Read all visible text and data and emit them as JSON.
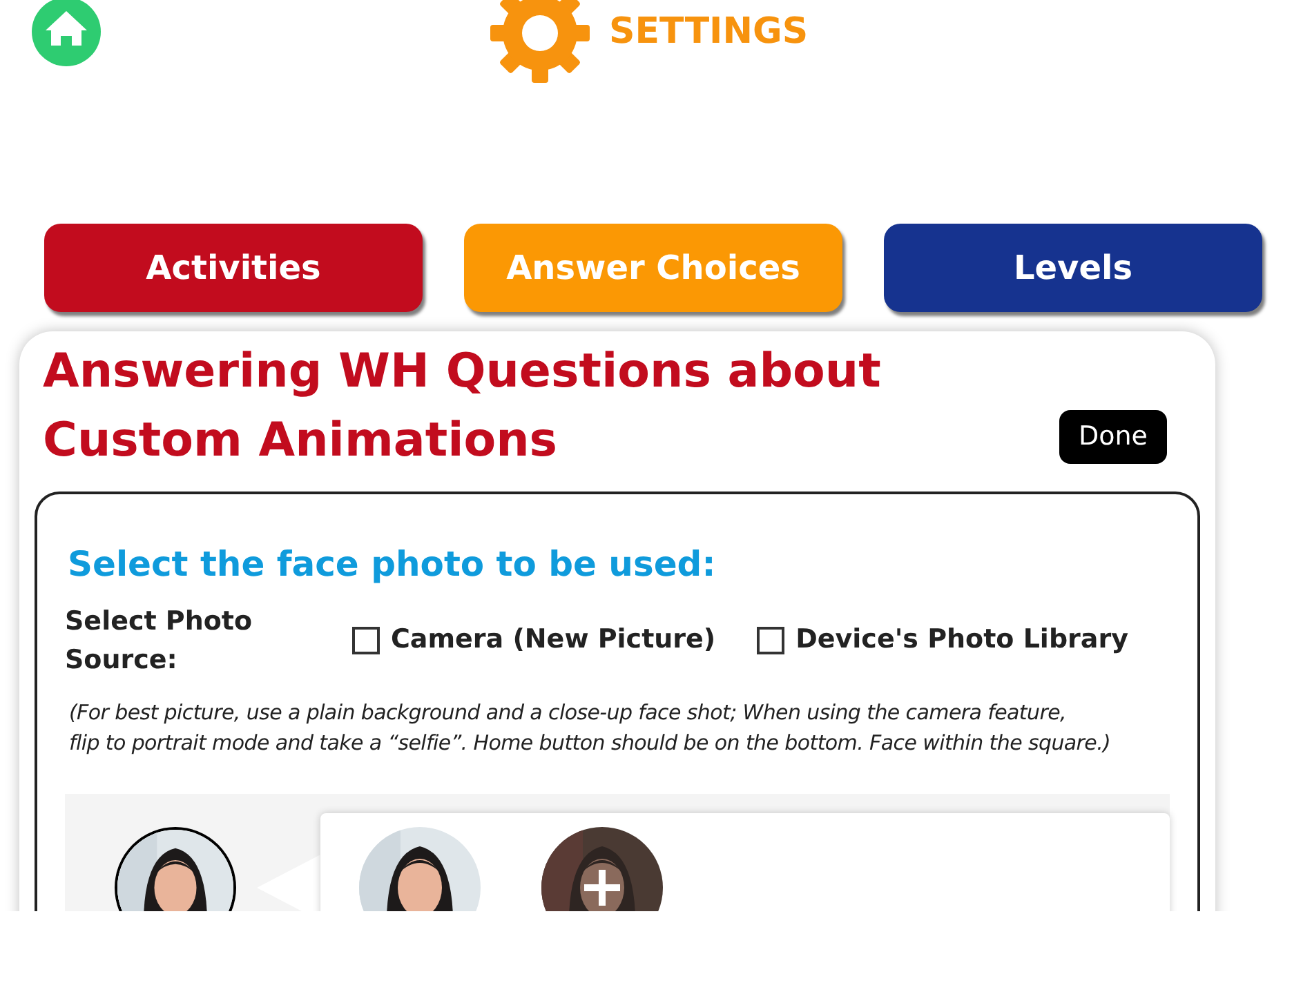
{
  "header": {
    "title": "SETTINGS"
  },
  "tabs": [
    {
      "label": "Activities",
      "color": "#c20c1e"
    },
    {
      "label": "Answer Choices",
      "color": "#fb9804"
    },
    {
      "label": "Levels",
      "color": "#16338f"
    }
  ],
  "panel": {
    "title_lines": [
      "Answering WH Questions about",
      "Custom Animations"
    ],
    "done_button": "Done",
    "section_heading": "Select the face photo to be used:",
    "source_label": "Select Photo Source:",
    "sources": [
      {
        "label": "Camera (New Picture)",
        "checked": false
      },
      {
        "label": "Device's Photo Library",
        "checked": false
      }
    ],
    "note_lines": [
      "(For best picture, use a plain background and a close-up face shot; When using the camera feature,",
      "flip to portrait mode and take a “selfie”. Home button should be on the bottom. Face within the square.)"
    ],
    "current_photo": {
      "kind": "picture"
    },
    "photos": [
      {
        "kind": "picture"
      },
      {
        "kind": "add"
      }
    ]
  }
}
